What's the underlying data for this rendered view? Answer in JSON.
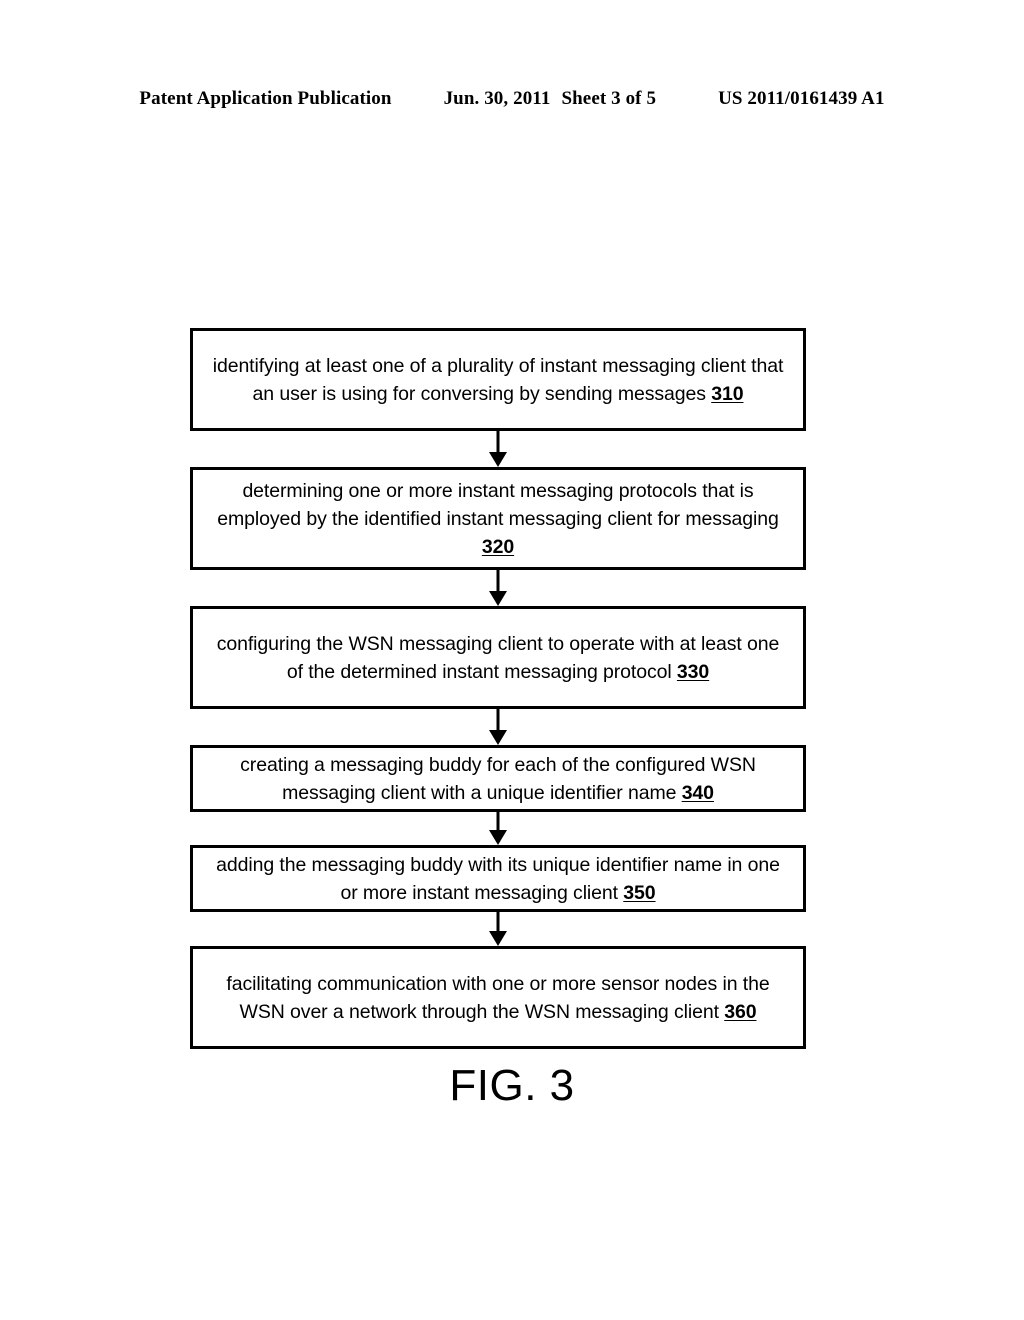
{
  "header": {
    "publication": "Patent Application Publication",
    "date": "Jun. 30, 2011",
    "sheet": "Sheet 3 of 5",
    "patent_number": "US 2011/0161439 A1"
  },
  "figure": {
    "caption": "FIG. 3",
    "type": "flowchart",
    "steps": [
      {
        "ref": "310",
        "text": "identifying at least one of a plurality of instant messaging client that an user is using for conversing by sending messages ",
        "full_text": "identifying at least one of a plurality of instant messaging client that an user is using for conversing by sending messages 310"
      },
      {
        "ref": "320",
        "text": "determining one or more instant messaging protocols that is employed by the identified instant messaging client for messaging ",
        "full_text": "determining one or more instant messaging protocols that is employed by the identified instant messaging client for messaging 320"
      },
      {
        "ref": "330",
        "text": "configuring the WSN messaging client to operate with at least one of the determined instant messaging protocol ",
        "full_text": "configuring the WSN messaging client to operate with at least one of the determined instant messaging protocol 330"
      },
      {
        "ref": "340",
        "text": "creating a messaging buddy for each of the configured WSN messaging client with a unique identifier name ",
        "full_text": "creating a messaging buddy for each of the configured WSN messaging client with a unique identifier name 340"
      },
      {
        "ref": "350",
        "text": "adding the messaging buddy with its unique identifier name in one or more instant messaging client ",
        "full_text": "adding the messaging buddy with its unique identifier name in one or more instant messaging client 350"
      },
      {
        "ref": "360",
        "text": "facilitating communication with one or more sensor nodes in the WSN over a network through the WSN messaging client ",
        "full_text": "facilitating communication with one or more sensor nodes in the WSN over a network through the WSN messaging client 360"
      }
    ]
  },
  "colors": {
    "ink": "#000000",
    "paper": "#ffffff"
  }
}
